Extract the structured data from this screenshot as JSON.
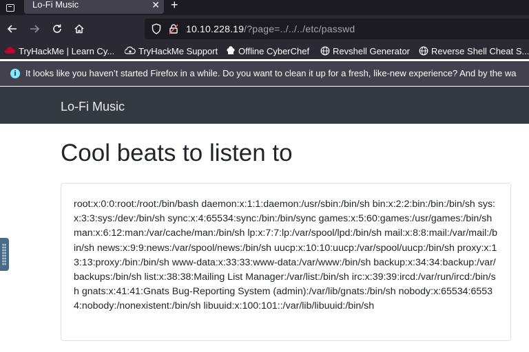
{
  "browser": {
    "tab_title": "Lo-Fi Music",
    "tab_close": "✕",
    "new_tab": "+",
    "url_host": "10.10.228.19",
    "url_path": "/?page=../../../etc/passwd",
    "bookmarks": [
      {
        "label": "TryHackMe | Learn Cy...",
        "icon": "tryhackme-icon",
        "color": "#c3002f"
      },
      {
        "label": "TryHackMe Support",
        "icon": "support-icon"
      },
      {
        "label": "Offline CyberChef",
        "icon": "chef-icon"
      },
      {
        "label": "Revshell Generator",
        "icon": "globe-icon"
      },
      {
        "label": "Reverse Shell Cheat S...",
        "icon": "globe-icon"
      }
    ],
    "notification": "It looks like you haven’t started Firefox in a while. Do you want to clean it up for a fresh, like-new experience? And by the wa"
  },
  "site": {
    "brand": "Lo-Fi Music",
    "heading": "Cool beats to listen to",
    "content": "root:x:0:0:root:/root:/bin/bash daemon:x:1:1:daemon:/usr/sbin:/bin/sh bin:x:2:2:bin:/bin:/bin/sh sys:x:3:3:sys:/dev:/bin/sh sync:x:4:65534:sync:/bin:/bin/sync games:x:5:60:games:/usr/games:/bin/sh man:x:6:12:man:/var/cache/man:/bin/sh lp:x:7:7:lp:/var/spool/lpd:/bin/sh mail:x:8:8:mail:/var/mail:/bin/sh news:x:9:9:news:/var/spool/news:/bin/sh uucp:x:10:10:uucp:/var/spool/uucp:/bin/sh proxy:x:13:13:proxy:/bin:/bin/sh www-data:x:33:33:www-data:/var/www:/bin/sh backup:x:34:34:backup:/var/backups:/bin/sh list:x:38:38:Mailing List Manager:/var/list:/bin/sh irc:x:39:39:ircd:/var/run/ircd:/bin/sh gnats:x:41:41:Gnats Bug-Reporting System (admin):/var/lib/gnats:/bin/sh nobody:x:65534:65534:nobody:/nonexistent:/bin/sh libuuid:x:100:101::/var/lib/libuuid:/bin/sh"
  },
  "colors": {
    "chrome_dark": "#1c1b22",
    "chrome": "#2b2a33",
    "site_navbar": "#343a40",
    "notice_icon": "#80ebff"
  }
}
